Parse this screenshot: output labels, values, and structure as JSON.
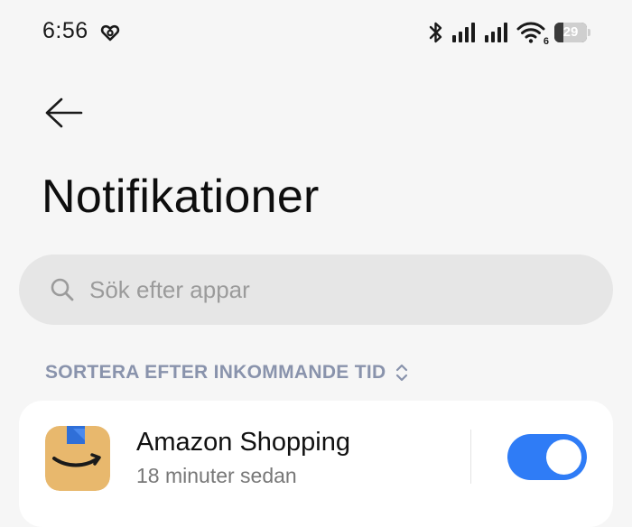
{
  "status_bar": {
    "time": "6:56",
    "left_icon": "heart-link-icon",
    "icons": [
      "bluetooth-icon",
      "signal-icon",
      "signal-icon",
      "wifi-icon"
    ],
    "wifi_badge": "6",
    "battery_level": "29",
    "battery_fraction": 0.29
  },
  "header": {
    "back_icon": "arrow-left-icon",
    "title": "Notifikationer"
  },
  "search": {
    "icon": "search-icon",
    "placeholder": "Sök efter appar",
    "value": ""
  },
  "sort": {
    "label": "SORTERA EFTER INKOMMANDE TID",
    "icon": "sort-chevrons-icon"
  },
  "apps": [
    {
      "name": "Amazon Shopping",
      "time": "18 minuter sedan",
      "icon": "amazon-shopping-icon",
      "enabled": true
    }
  ],
  "colors": {
    "background": "#f6f6f6",
    "search_background": "#e6e6e6",
    "sort_label": "#8993ac",
    "toggle_on": "#2f7cf6",
    "amazon_box": "#e8b86d",
    "amazon_tape": "#2f6fd8"
  }
}
